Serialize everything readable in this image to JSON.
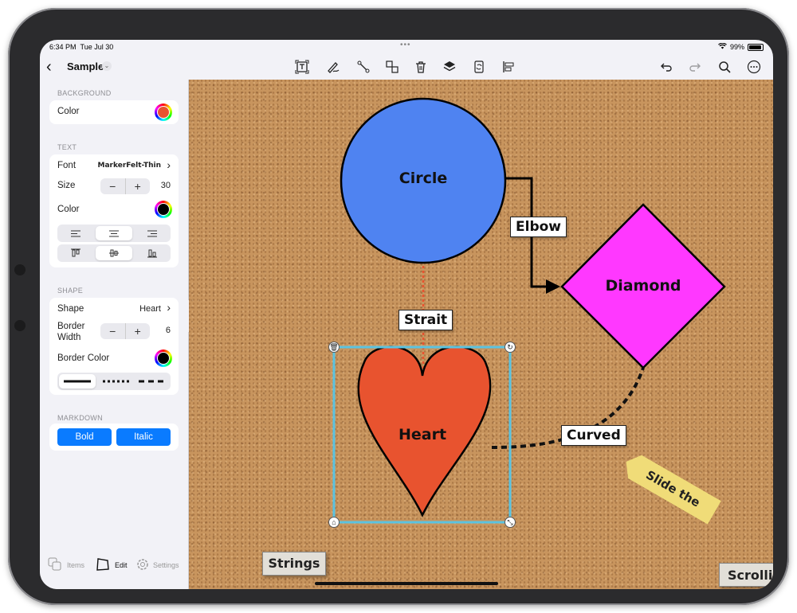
{
  "status_bar": {
    "time": "6:34 PM",
    "date": "Tue Jul 30",
    "battery": "99%"
  },
  "nav": {
    "title": "Sample"
  },
  "toolbar_icons": [
    "text-box-icon",
    "pen-icon",
    "connector-icon",
    "group-icon",
    "trash-icon",
    "layers-icon",
    "rotate-page-icon",
    "align-icon",
    "undo-icon",
    "redo-icon",
    "search-icon",
    "more-icon"
  ],
  "sidebar": {
    "background": {
      "header": "BACKGROUND",
      "color_label": "Color",
      "color_value": "#e8532f"
    },
    "text": {
      "header": "TEXT",
      "font_label": "Font",
      "font_value": "MarkerFelt-Thin",
      "size_label": "Size",
      "size_value": "30",
      "color_label": "Color",
      "color_value": "#000000",
      "minus": "−",
      "plus": "+"
    },
    "shape": {
      "header": "SHAPE",
      "shape_label": "Shape",
      "shape_value": "Heart",
      "border_width_label": "Border Width",
      "border_width_value": "6",
      "border_color_label": "Border Color",
      "border_color_value": "#000000"
    },
    "markdown": {
      "header": "MARKDOWN",
      "bold": "Bold",
      "italic": "Italic"
    },
    "tabs": {
      "items": "Items",
      "edit": "Edit",
      "settings": "Settings"
    }
  },
  "canvas": {
    "circle": {
      "label": "Circle",
      "color": "#4f83f1"
    },
    "diamond": {
      "label": "Diamond",
      "color": "#ff38ff"
    },
    "heart": {
      "label": "Heart",
      "color": "#e8532f"
    },
    "connectors": {
      "elbow": "Elbow",
      "strait": "Strait",
      "curved": "Curved"
    },
    "sticky": "Slide the Boxes",
    "notes": {
      "strings": "Strings",
      "scrolling": "Scrolli"
    }
  }
}
